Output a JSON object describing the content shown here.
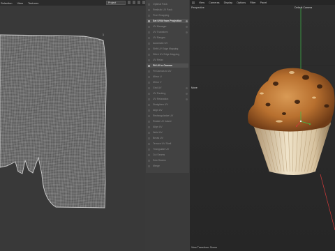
{
  "uv_editor": {
    "menu": [
      "Selection",
      "View",
      "Textures"
    ],
    "project_dropdown": "Project",
    "corner_label": "1"
  },
  "tools": [
    {
      "label": "Optimal Pack",
      "active": false,
      "option": false
    },
    {
      "label": "Realistic UV Pack",
      "active": false,
      "option": false
    },
    {
      "label": "Pixel Snapping",
      "active": false,
      "option": false
    },
    {
      "label": "Set UVW from Projection",
      "active": true,
      "option": true
    },
    {
      "label": "UV Manager",
      "active": false,
      "option": true
    },
    {
      "label": "UV Transform",
      "active": false,
      "option": true
    },
    {
      "label": "UV Ranges",
      "active": false,
      "option": false
    },
    {
      "label": "Automatic UV",
      "active": false,
      "option": false
    },
    {
      "label": "Shift UV Edge Mapping",
      "active": false,
      "option": false
    },
    {
      "label": "Stitch UV Edge Mapping",
      "active": false,
      "option": false
    },
    {
      "label": "UV Relax",
      "active": false,
      "option": false
    },
    {
      "label": "Fit UV to Canvas",
      "active": true,
      "option": false
    },
    {
      "label": "Fit Canvas to UV",
      "active": false,
      "option": false
    },
    {
      "label": "Mirror U",
      "active": false,
      "option": false
    },
    {
      "label": "Mirror V",
      "active": false,
      "option": false
    },
    {
      "label": "Grid UV",
      "active": false,
      "option": true
    },
    {
      "label": "UV Packing",
      "active": false,
      "option": true
    },
    {
      "label": "UV Relaxation",
      "active": false,
      "option": true
    },
    {
      "label": "Straighten UV",
      "active": false,
      "option": false
    },
    {
      "label": "Align UV",
      "active": false,
      "option": false
    },
    {
      "label": "Rectangularize UV",
      "active": false,
      "option": false
    },
    {
      "label": "Rotate UV Island",
      "active": false,
      "option": false
    },
    {
      "label": "Align UV",
      "active": false,
      "option": false
    },
    {
      "label": "Weld UV",
      "active": false,
      "option": false
    },
    {
      "label": "Break UV",
      "active": false,
      "option": false
    },
    {
      "label": "Terrace UV Shell",
      "active": false,
      "option": false
    },
    {
      "label": "Triangulate UV",
      "active": false,
      "option": false
    },
    {
      "label": "Cut Seams",
      "active": false,
      "option": false
    },
    {
      "label": "Sew Seams",
      "active": false,
      "option": false
    },
    {
      "label": "Merge",
      "active": false,
      "option": false
    }
  ],
  "viewport": {
    "menu": [
      "View",
      "Cameras",
      "Display",
      "Options",
      "Filter",
      "Panel"
    ],
    "perspective_label": "Perspective",
    "camera_label": "Default Camera",
    "move_label": "Move",
    "status_label": "View Transform: Scene"
  },
  "colors": {
    "uv_background": "#393939",
    "uv_wire": "#cfcfcf",
    "viewport_background": "#2c2c2c",
    "axis_green": "#3fbf4a",
    "axis_red": "#d33a3a",
    "axis_blue": "#3b6fe0"
  }
}
